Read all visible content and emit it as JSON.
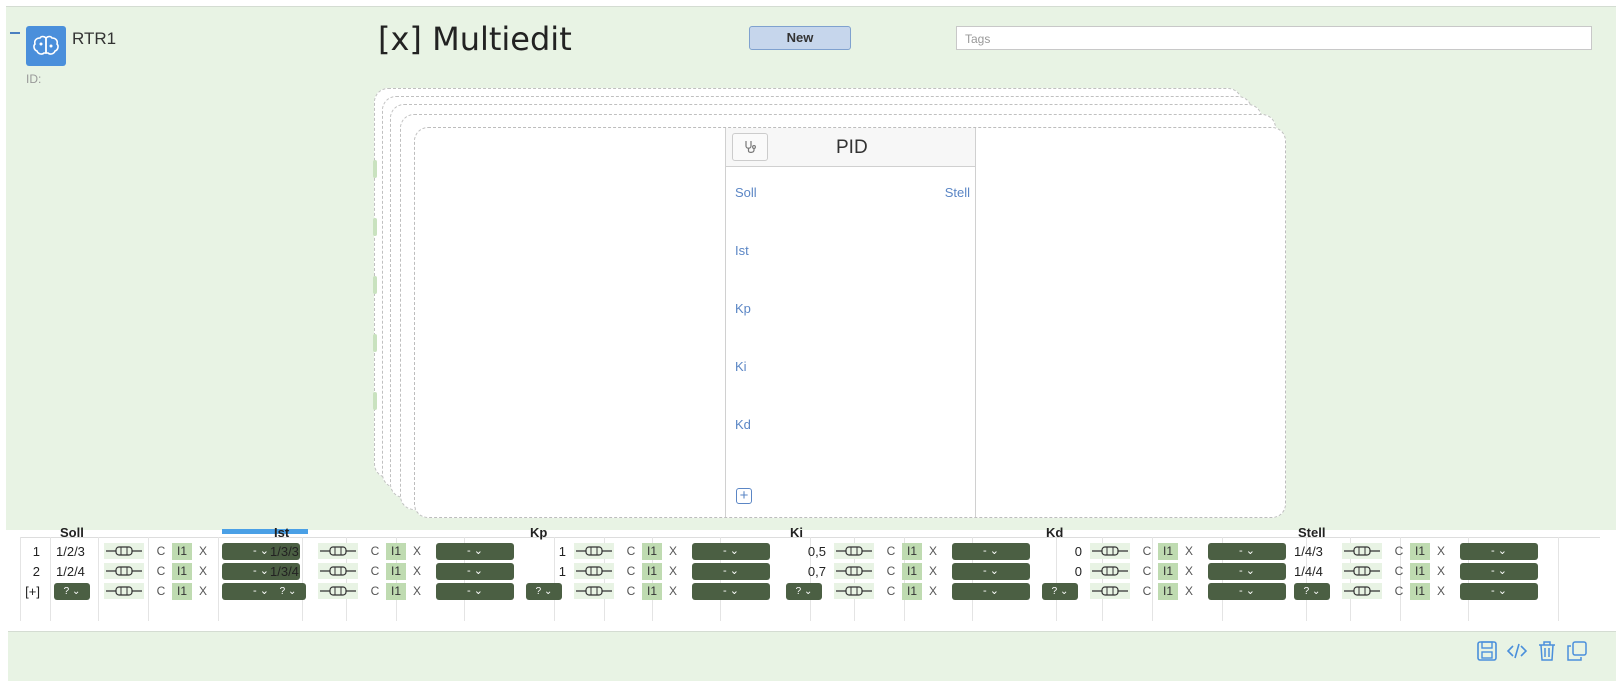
{
  "header": {
    "node_name": "RTR1",
    "id_label": "ID:",
    "title": "[x] Multiedit",
    "new_label": "New",
    "tags_placeholder": "Tags"
  },
  "block": {
    "title": "PID",
    "inputs": [
      "Soll",
      "Ist",
      "Kp",
      "Ki",
      "Kd"
    ],
    "output": "Stell"
  },
  "grid": {
    "columns": [
      "Soll",
      "Ist",
      "Kp",
      "Ki",
      "Kd",
      "Stell"
    ],
    "rows": [
      {
        "num": "1",
        "values": [
          "1/2/3",
          "1/3/3",
          "1",
          "0,5",
          "0",
          "1/4/3"
        ]
      },
      {
        "num": "2",
        "values": [
          "1/2/4",
          "1/3/4",
          "1",
          "0,7",
          "0",
          "1/4/4"
        ]
      }
    ],
    "add_row_label": "[+]",
    "ctrl_c": "C",
    "ctrl_i": "I1",
    "ctrl_x": "X",
    "dropdown_label": "- ⌄",
    "query_label": "? ⌄"
  },
  "icons": [
    "brain-icon",
    "stethoscope-icon",
    "plus-icon",
    "save-icon",
    "code-icon",
    "trash-icon",
    "copy-icon",
    "connector-icon"
  ],
  "colors": {
    "accent": "#4a8fdb",
    "panel": "#e8f3e4",
    "dropdown": "#4b5f43",
    "link": "#5b86c5"
  }
}
